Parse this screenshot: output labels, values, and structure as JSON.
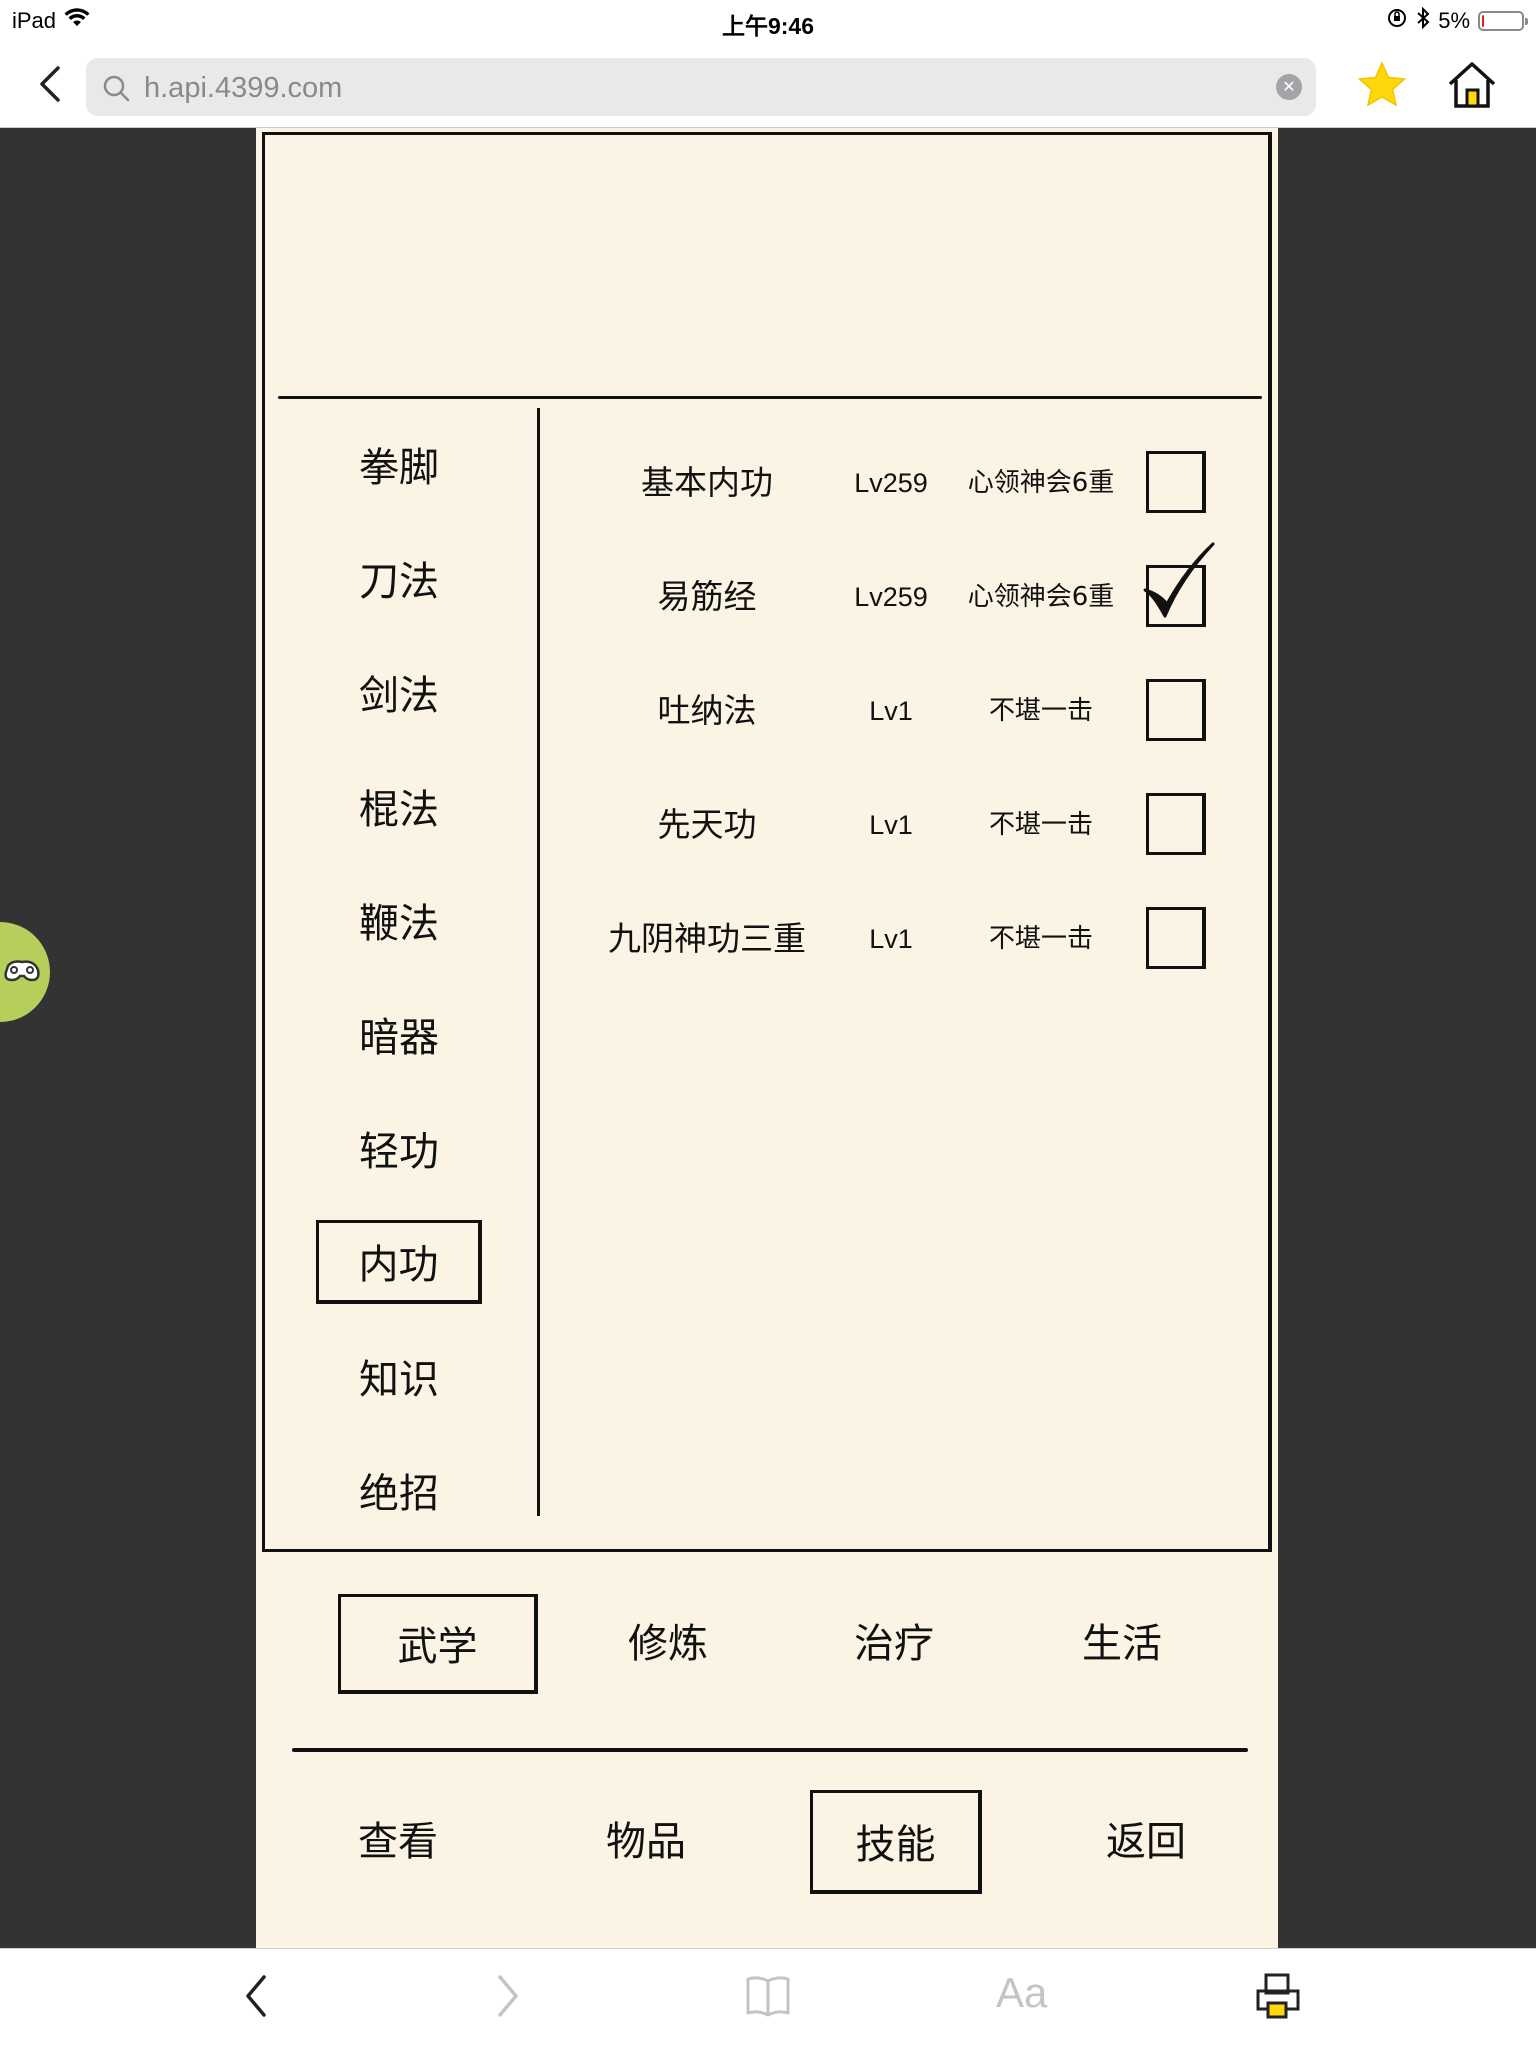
{
  "status": {
    "device": "iPad",
    "time": "上午9:46",
    "battery_percent": "5%",
    "battery_level": 0.05
  },
  "browser": {
    "url": "h.api.4399.com",
    "icons": [
      "back-icon",
      "search-icon",
      "clear-icon",
      "favorite-star-icon",
      "home-icon"
    ]
  },
  "categories": [
    "拳脚",
    "刀法",
    "剑法",
    "棍法",
    "鞭法",
    "暗器",
    "轻功",
    "内功",
    "知识",
    "绝招"
  ],
  "selected_category": "内功",
  "skills": [
    {
      "name": "基本内功",
      "level": "Lv259",
      "rank": "心领神会6重",
      "checked": false
    },
    {
      "name": "易筋经",
      "level": "Lv259",
      "rank": "心领神会6重",
      "checked": true
    },
    {
      "name": "吐纳法",
      "level": "Lv1",
      "rank": "不堪一击",
      "checked": false
    },
    {
      "name": "先天功",
      "level": "Lv1",
      "rank": "不堪一击",
      "checked": false
    },
    {
      "name": "九阴神功三重",
      "level": "Lv1",
      "rank": "不堪一击",
      "checked": false
    }
  ],
  "tabs": [
    "武学",
    "修炼",
    "治疗",
    "生活"
  ],
  "selected_tab": "武学",
  "bottom_nav": [
    "查看",
    "物品",
    "技能",
    "返回"
  ],
  "selected_bottom": "技能",
  "safari_bar": {
    "text_size_label": "Aa",
    "icons": [
      "back-icon",
      "forward-icon",
      "bookmarks-icon",
      "text-size-icon",
      "share-icon"
    ]
  },
  "colors": {
    "game_background": "#fbf4e4",
    "page_background": "#333333",
    "ink": "#111111",
    "assistant_green": "#b5cf5a"
  }
}
